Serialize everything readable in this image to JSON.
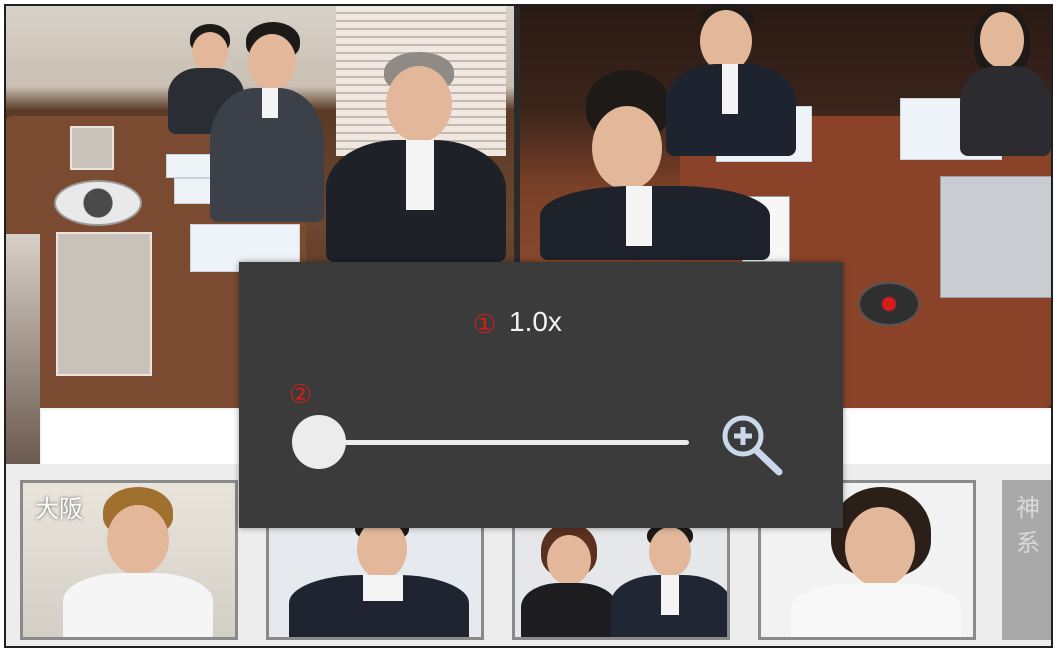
{
  "main_feed": {
    "left_label": "",
    "right_label": ""
  },
  "zoom_control": {
    "zoom_level": "1.0x",
    "level_fraction": 0.0,
    "markers": {
      "zoom_value": "①",
      "slider": "②"
    },
    "icon": "zoom-in-icon",
    "colors": {
      "panel": "#3b3b3b",
      "marker": "#d0201a",
      "accent": "#c9d8ea"
    }
  },
  "thumbnails": [
    {
      "label": "大阪"
    },
    {
      "label": ""
    },
    {
      "label": ""
    },
    {
      "label": ""
    },
    {
      "label": "神系"
    }
  ]
}
